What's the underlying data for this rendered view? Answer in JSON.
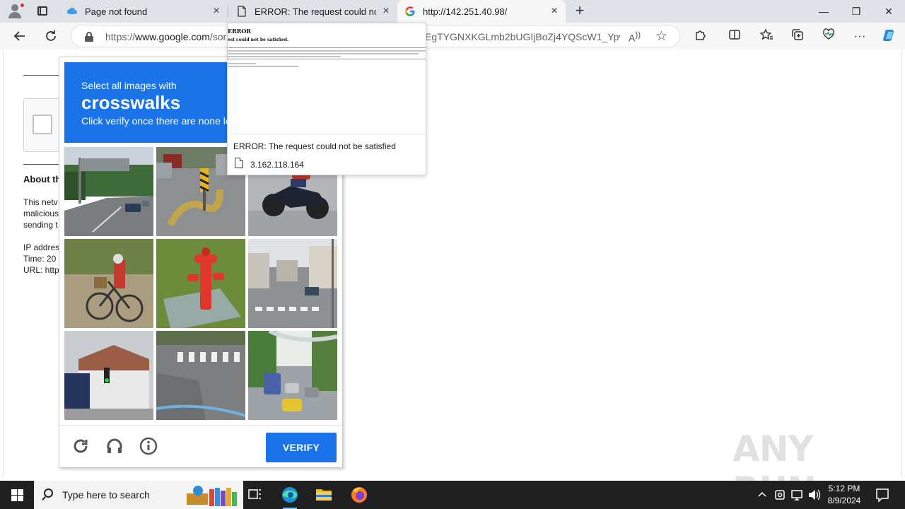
{
  "browser": {
    "tabs": [
      {
        "title": "Page not found",
        "icon": "cloud-icon",
        "active": false
      },
      {
        "title": "ERROR: The request could not be satisfied",
        "icon": "document-icon",
        "active": false
      },
      {
        "title": "http://142.251.40.98/",
        "icon": "google-icon",
        "active": true
      }
    ],
    "address": {
      "scheme_host": "https://",
      "host_bold": "www.google.com",
      "path_start": "/sor",
      "path_end": "EgTYGNXKGLmb2bUGIjBoZj4YQScW1_Ypv..."
    },
    "window_controls": {
      "minimize": "—",
      "maximize": "❐",
      "close": "✕"
    }
  },
  "background_page": {
    "heading": "About th",
    "paragraph": [
      "This netv",
      "malicious",
      "sending t"
    ],
    "details": [
      "IP addres",
      "Time: 20",
      "URL: http"
    ]
  },
  "captcha": {
    "line1": "Select all images with",
    "keyword": "crosswalks",
    "line3": "Click verify once there are none left",
    "verify_label": "VERIFY",
    "tiles": [
      "highway-sign",
      "curb-with-sign",
      "motorcyclist",
      "cyclist",
      "fire-hydrant",
      "street-crosswalk",
      "building-traffic-light",
      "road-crosswalk",
      "street-traffic"
    ],
    "colors": {
      "accent": "#1a73e8"
    }
  },
  "tab_preview": {
    "thumb_title": "ERROR",
    "thumb_subtitle": "est could not be satisfied.",
    "title": "ERROR: The request could not be satisfied",
    "ip": "3.162.118.164"
  },
  "watermark": "ANY RUN",
  "taskbar": {
    "search_placeholder": "Type here to search",
    "time": "5:12 PM",
    "date": "8/9/2024"
  }
}
